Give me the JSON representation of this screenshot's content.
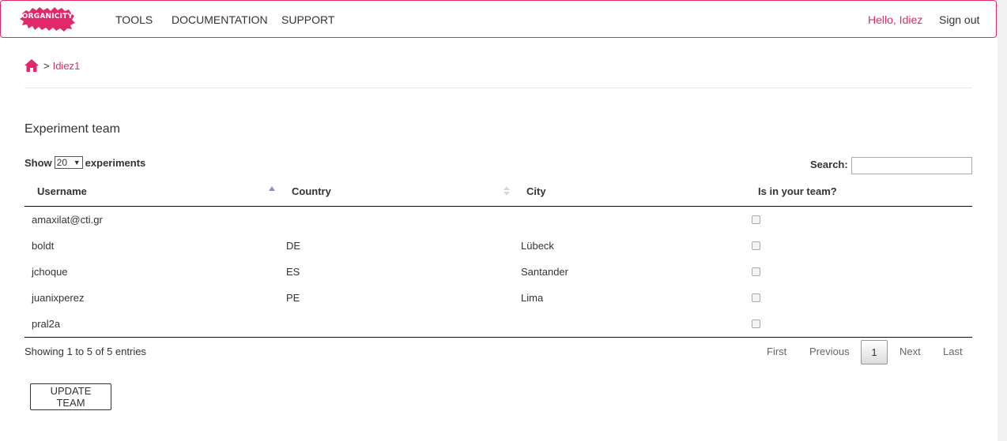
{
  "colors": {
    "accent": "#e0286a",
    "sort_active": "#8a8fd0"
  },
  "navbar": {
    "logo_text": "ORGANICITY",
    "items": [
      "TOOLS",
      "DOCUMENTATION",
      "SUPPORT"
    ],
    "greeting": "Hello, Idiez",
    "sign_out": "Sign out"
  },
  "breadcrumb": {
    "home_icon": "home-icon",
    "separator": ">",
    "current": "Idiez1"
  },
  "section_title": "Experiment team",
  "length_control": {
    "prefix": "Show",
    "selected": "20",
    "suffix": "experiments"
  },
  "search": {
    "label": "Search:",
    "value": ""
  },
  "table": {
    "columns": [
      "Username",
      "Country",
      "City",
      "Is in your team?"
    ],
    "sorted_column": "Username",
    "sort_direction": "ascending",
    "rows": [
      {
        "username": "amaxilat@cti.gr",
        "country": "",
        "city": "",
        "in_team": false
      },
      {
        "username": "boldt",
        "country": "DE",
        "city": "Lübeck",
        "in_team": false
      },
      {
        "username": "jchoque",
        "country": "ES",
        "city": "Santander",
        "in_team": false
      },
      {
        "username": "juanixperez",
        "country": "PE",
        "city": "Lima",
        "in_team": false
      },
      {
        "username": "pral2a",
        "country": "",
        "city": "",
        "in_team": false
      }
    ]
  },
  "info": "Showing 1 to 5 of 5 entries",
  "pagination": {
    "first": "First",
    "previous": "Previous",
    "current": "1",
    "next": "Next",
    "last": "Last"
  },
  "update_button": "UPDATE TEAM"
}
